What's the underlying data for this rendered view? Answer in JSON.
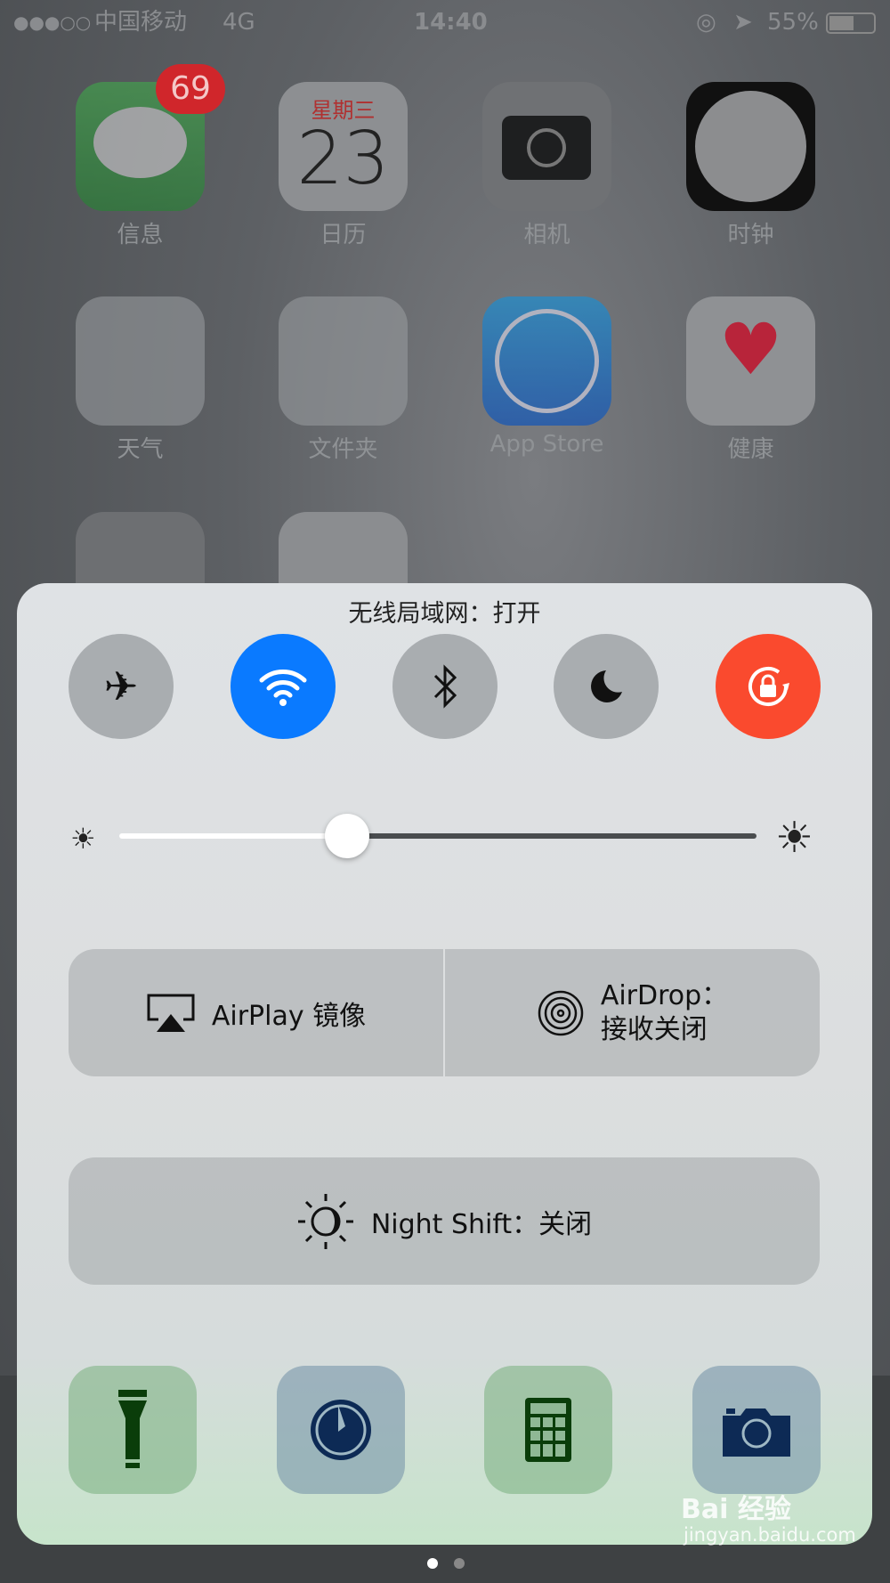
{
  "status_bar": {
    "signal": "●●●○○",
    "carrier": "中国移动",
    "network": "4G",
    "time": "14:40",
    "battery": "55%"
  },
  "apps": [
    {
      "label": "信息",
      "badge": "69"
    },
    {
      "label": "日历",
      "weekday": "星期三",
      "day": "23"
    },
    {
      "label": "相机"
    },
    {
      "label": "时钟"
    },
    {
      "label": "天气"
    },
    {
      "label": "文件夹"
    },
    {
      "label": "App Store"
    },
    {
      "label": "健康"
    }
  ],
  "control_center": {
    "title": "无线局域网：打开",
    "toggles": [
      {
        "name": "airplane",
        "on": false
      },
      {
        "name": "wifi",
        "on": true,
        "color": "#0a7aff"
      },
      {
        "name": "bluetooth",
        "on": false
      },
      {
        "name": "do-not-disturb",
        "on": false
      },
      {
        "name": "rotation-lock",
        "on": true,
        "color": "#fa4a2e"
      }
    ],
    "brightness": 0.36,
    "airplay_label": "AirPlay 镜像",
    "airdrop_label_1": "AirDrop：",
    "airdrop_label_2": "接收关闭",
    "night_shift_label": "Night Shift：关闭",
    "shortcuts": [
      "flashlight",
      "timer",
      "calculator",
      "camera"
    ]
  },
  "page_indicator": {
    "pages": 2,
    "current": 1
  },
  "watermark": {
    "brand": "Bai 经验",
    "url": "jingyan.baidu.com"
  }
}
